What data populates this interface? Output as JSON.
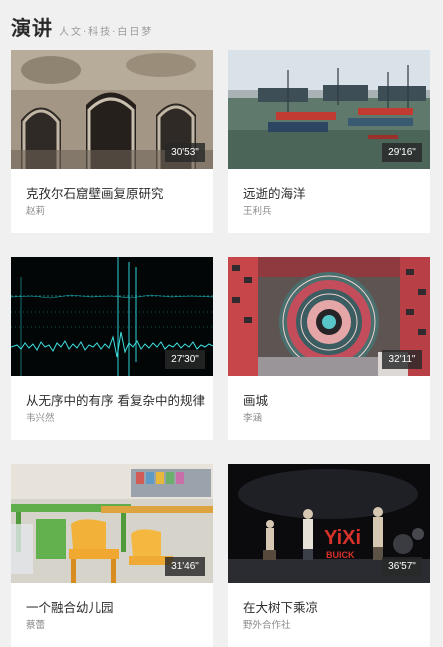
{
  "header": {
    "title": "演讲",
    "subtitle": "人文·科技·白日梦"
  },
  "talks": [
    {
      "title": "克孜尔石窟壁画复原研究",
      "author": "赵莉",
      "duration": "30'53\""
    },
    {
      "title": "远逝的海洋",
      "author": "王利兵",
      "duration": "29'16\""
    },
    {
      "title": "从无序中的有序 看复杂中的规律",
      "author": "韦兴然",
      "duration": "27'30\""
    },
    {
      "title": "画城",
      "author": "李涵",
      "duration": "32'11\""
    },
    {
      "title": "一个融合幼儿园",
      "author": "蔡蕾",
      "duration": "31'46\""
    },
    {
      "title": "在大树下乘凉",
      "author": "野外合作社",
      "duration": "36'57\""
    }
  ],
  "thumb_text": {
    "stage_logo": "YiXi",
    "stage_sponsor": "BUICK"
  }
}
